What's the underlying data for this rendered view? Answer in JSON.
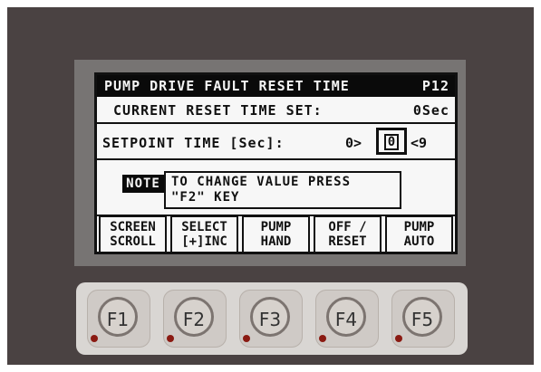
{
  "lcd": {
    "title": "PUMP DRIVE FAULT RESET TIME",
    "page": "P12",
    "current_label": "CURRENT RESET TIME SET:",
    "current_value": "0Sec",
    "setpoint_label": "SETPOINT TIME [Sec]:",
    "setpoint_min": "0>",
    "setpoint_value": "0",
    "setpoint_max": "<9",
    "note_tag": "NOTE",
    "note_line1": "TO CHANGE VALUE PRESS",
    "note_line2": "\"F2\" KEY",
    "softkeys": [
      {
        "line1": "SCREEN",
        "line2": "SCROLL"
      },
      {
        "line1": "SELECT",
        "line2": "[+]INC"
      },
      {
        "line1": "PUMP",
        "line2": "HAND"
      },
      {
        "line1": "OFF /",
        "line2": "RESET"
      },
      {
        "line1": "PUMP",
        "line2": "AUTO"
      }
    ]
  },
  "keys": [
    "F1",
    "F2",
    "F3",
    "F4",
    "F5"
  ]
}
